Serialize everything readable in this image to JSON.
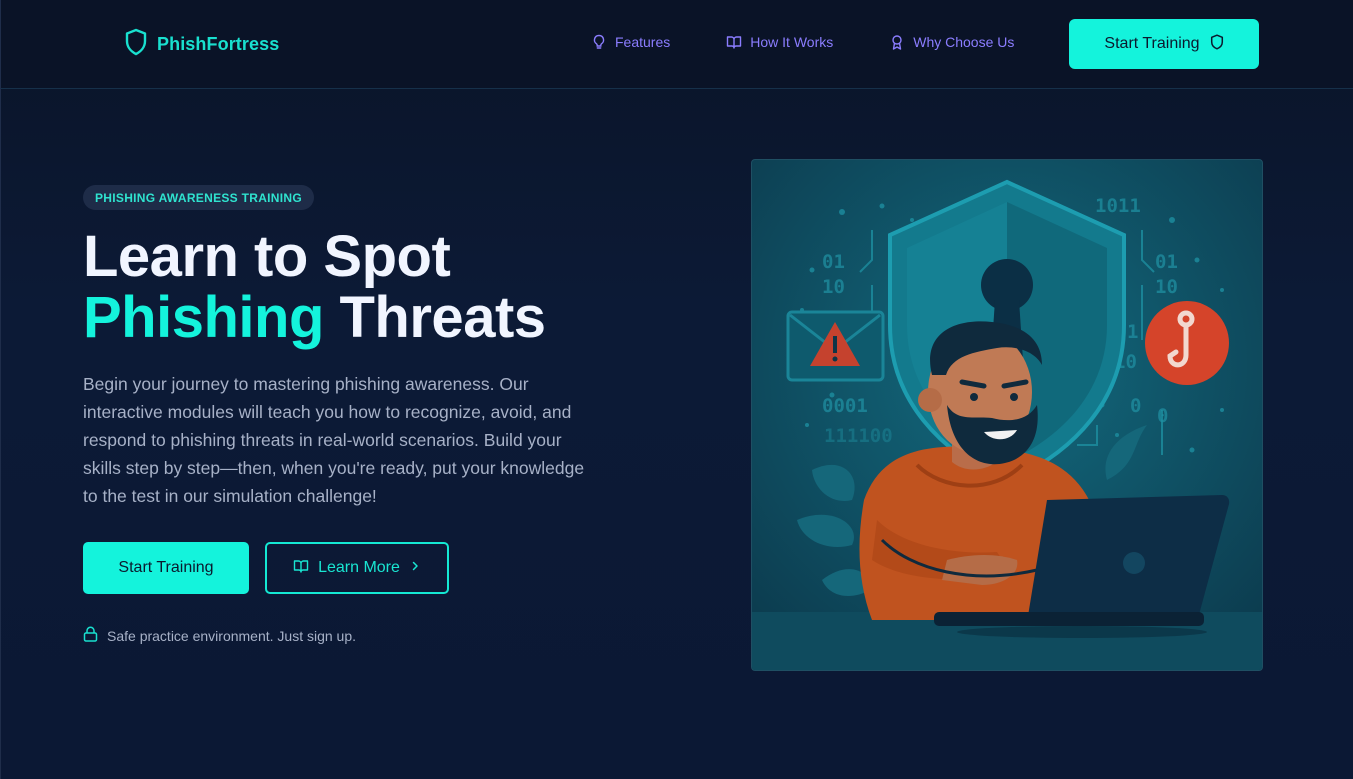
{
  "brand": {
    "name": "PhishFortress",
    "logo_icon": "shield-icon"
  },
  "nav": {
    "items": [
      {
        "label": "Features",
        "icon": "lightbulb-icon"
      },
      {
        "label": "How It Works",
        "icon": "book-icon"
      },
      {
        "label": "Why Choose Us",
        "icon": "award-icon"
      }
    ],
    "cta_label": "Start Training",
    "cta_icon": "shield-icon"
  },
  "hero": {
    "badge": "PHISHING AWARENESS TRAINING",
    "title_line1": "Learn to Spot",
    "title_accent": "Phishing",
    "title_line2_rest": " Threats",
    "description": "Begin your journey to mastering phishing awareness. Our interactive modules will teach you how to recognize, avoid, and respond to phishing threats in real-world scenarios. Build your skills step by step—then, when you're ready, put your knowledge to the test in our simulation challenge!",
    "primary_button": "Start Training",
    "secondary_button": "Learn More",
    "note": "Safe practice environment. Just sign up."
  },
  "illustration": {
    "binary_texts": [
      "1011",
      "01",
      "10",
      "01",
      "10",
      "0001",
      "111100",
      "1",
      "10",
      "0",
      "0"
    ]
  },
  "colors": {
    "accent": "#14f3dc",
    "nav_link": "#8b7dff",
    "background": "#0b1730",
    "hook_badge": "#d5442a"
  }
}
